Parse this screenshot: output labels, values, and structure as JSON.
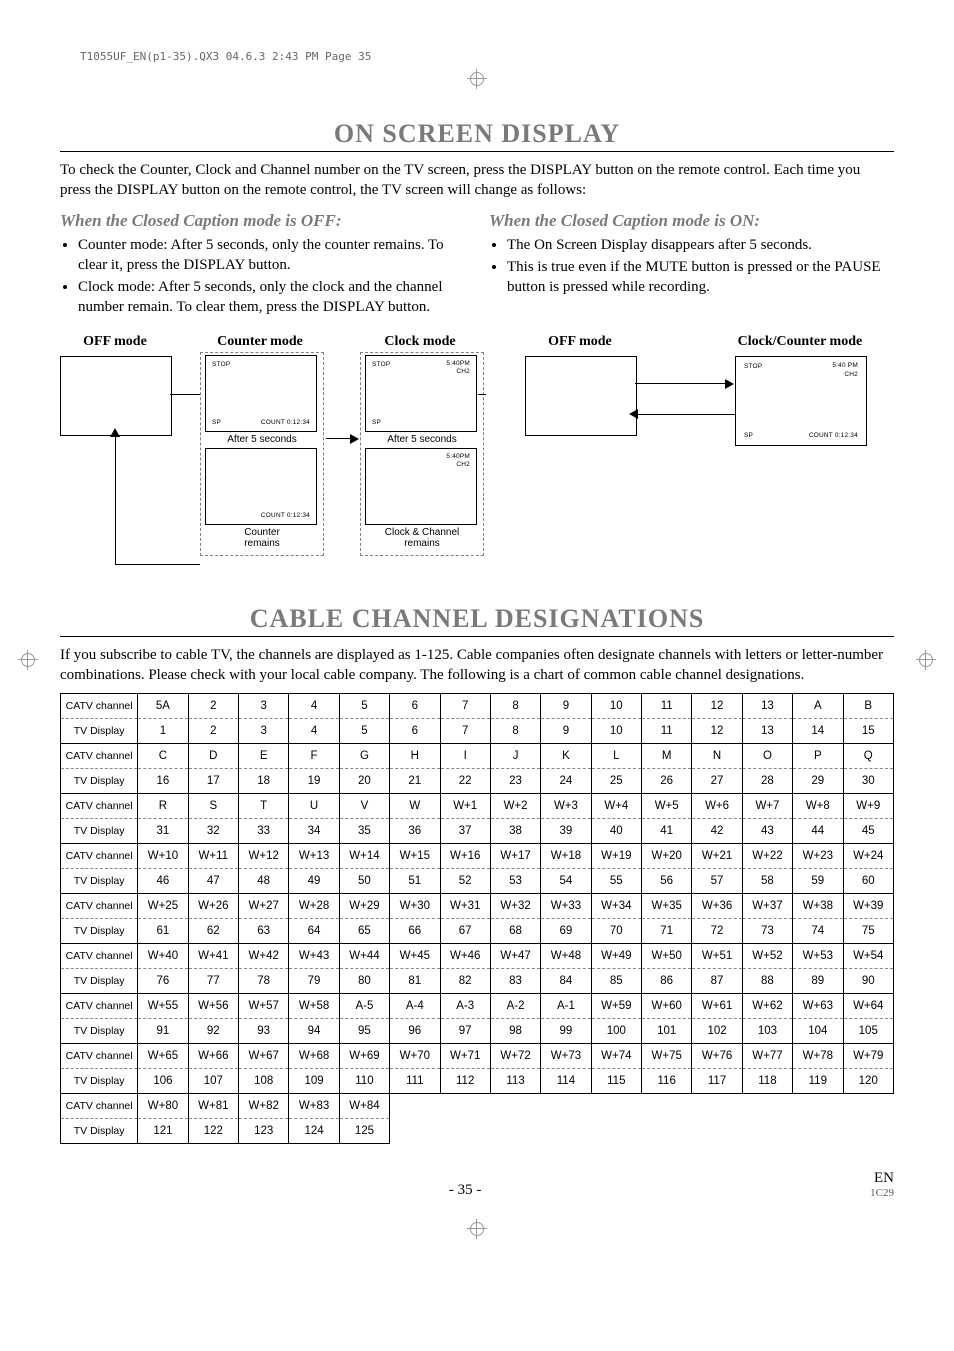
{
  "header_line": "T1055UF_EN(p1-35).QX3  04.6.3  2:43 PM  Page 35",
  "section1": {
    "title": "ON SCREEN DISPLAY",
    "intro": "To check the Counter, Clock and Channel number on the TV screen, press the DISPLAY button on the remote control. Each time you press the DISPLAY button on the remote control, the TV screen will change as follows:",
    "left": {
      "subhead": "When the Closed Caption mode is OFF:",
      "bullets": [
        "Counter mode: After 5 seconds, only the counter remains. To clear it, press the DISPLAY button.",
        "Clock mode: After 5 seconds, only the clock and the channel number remain. To clear them, press the DISPLAY button."
      ]
    },
    "right": {
      "subhead": "When the Closed Caption mode is ON:",
      "bullets": [
        "The On Screen Display disappears after 5 seconds.",
        "This is true even if the MUTE button is pressed or the PAUSE button is pressed while recording."
      ]
    },
    "labels": {
      "off": "OFF mode",
      "counter": "Counter mode",
      "clock": "Clock mode",
      "clock_counter": "Clock/Counter mode",
      "after5": "After 5 seconds",
      "counter_remains": "Counter\nremains",
      "clock_remains": "Clock & Channel\nremains"
    },
    "tv_strings": {
      "stop": "STOP",
      "sp": "SP",
      "count": "COUNT  0:12:34",
      "time": "5:40PM",
      "time2": "5:40 PM",
      "ch": "CH2"
    }
  },
  "section2": {
    "title": "CABLE CHANNEL DESIGNATIONS",
    "intro": "If you subscribe to cable TV, the channels are displayed as 1-125. Cable companies often designate channels with letters or letter-number combinations. Please check with your local cable company. The following is a chart of common cable channel designations.",
    "row_labels": {
      "catv": "CATV channel",
      "disp": "TV Display"
    },
    "rows": [
      {
        "catv": [
          "5A",
          "2",
          "3",
          "4",
          "5",
          "6",
          "7",
          "8",
          "9",
          "10",
          "11",
          "12",
          "13",
          "A",
          "B"
        ],
        "disp": [
          "1",
          "2",
          "3",
          "4",
          "5",
          "6",
          "7",
          "8",
          "9",
          "10",
          "11",
          "12",
          "13",
          "14",
          "15"
        ]
      },
      {
        "catv": [
          "C",
          "D",
          "E",
          "F",
          "G",
          "H",
          "I",
          "J",
          "K",
          "L",
          "M",
          "N",
          "O",
          "P",
          "Q"
        ],
        "disp": [
          "16",
          "17",
          "18",
          "19",
          "20",
          "21",
          "22",
          "23",
          "24",
          "25",
          "26",
          "27",
          "28",
          "29",
          "30"
        ]
      },
      {
        "catv": [
          "R",
          "S",
          "T",
          "U",
          "V",
          "W",
          "W+1",
          "W+2",
          "W+3",
          "W+4",
          "W+5",
          "W+6",
          "W+7",
          "W+8",
          "W+9"
        ],
        "disp": [
          "31",
          "32",
          "33",
          "34",
          "35",
          "36",
          "37",
          "38",
          "39",
          "40",
          "41",
          "42",
          "43",
          "44",
          "45"
        ]
      },
      {
        "catv": [
          "W+10",
          "W+11",
          "W+12",
          "W+13",
          "W+14",
          "W+15",
          "W+16",
          "W+17",
          "W+18",
          "W+19",
          "W+20",
          "W+21",
          "W+22",
          "W+23",
          "W+24"
        ],
        "disp": [
          "46",
          "47",
          "48",
          "49",
          "50",
          "51",
          "52",
          "53",
          "54",
          "55",
          "56",
          "57",
          "58",
          "59",
          "60"
        ]
      },
      {
        "catv": [
          "W+25",
          "W+26",
          "W+27",
          "W+28",
          "W+29",
          "W+30",
          "W+31",
          "W+32",
          "W+33",
          "W+34",
          "W+35",
          "W+36",
          "W+37",
          "W+38",
          "W+39"
        ],
        "disp": [
          "61",
          "62",
          "63",
          "64",
          "65",
          "66",
          "67",
          "68",
          "69",
          "70",
          "71",
          "72",
          "73",
          "74",
          "75"
        ]
      },
      {
        "catv": [
          "W+40",
          "W+41",
          "W+42",
          "W+43",
          "W+44",
          "W+45",
          "W+46",
          "W+47",
          "W+48",
          "W+49",
          "W+50",
          "W+51",
          "W+52",
          "W+53",
          "W+54"
        ],
        "disp": [
          "76",
          "77",
          "78",
          "79",
          "80",
          "81",
          "82",
          "83",
          "84",
          "85",
          "86",
          "87",
          "88",
          "89",
          "90"
        ]
      },
      {
        "catv": [
          "W+55",
          "W+56",
          "W+57",
          "W+58",
          "A-5",
          "A-4",
          "A-3",
          "A-2",
          "A-1",
          "W+59",
          "W+60",
          "W+61",
          "W+62",
          "W+63",
          "W+64"
        ],
        "disp": [
          "91",
          "92",
          "93",
          "94",
          "95",
          "96",
          "97",
          "98",
          "99",
          "100",
          "101",
          "102",
          "103",
          "104",
          "105"
        ]
      },
      {
        "catv": [
          "W+65",
          "W+66",
          "W+67",
          "W+68",
          "W+69",
          "W+70",
          "W+71",
          "W+72",
          "W+73",
          "W+74",
          "W+75",
          "W+76",
          "W+77",
          "W+78",
          "W+79"
        ],
        "disp": [
          "106",
          "107",
          "108",
          "109",
          "110",
          "111",
          "112",
          "113",
          "114",
          "115",
          "116",
          "117",
          "118",
          "119",
          "120"
        ]
      },
      {
        "catv": [
          "W+80",
          "W+81",
          "W+82",
          "W+83",
          "W+84"
        ],
        "disp": [
          "121",
          "122",
          "123",
          "124",
          "125"
        ]
      }
    ]
  },
  "footer": {
    "page": "- 35 -",
    "lang": "EN",
    "code": "1C29"
  }
}
